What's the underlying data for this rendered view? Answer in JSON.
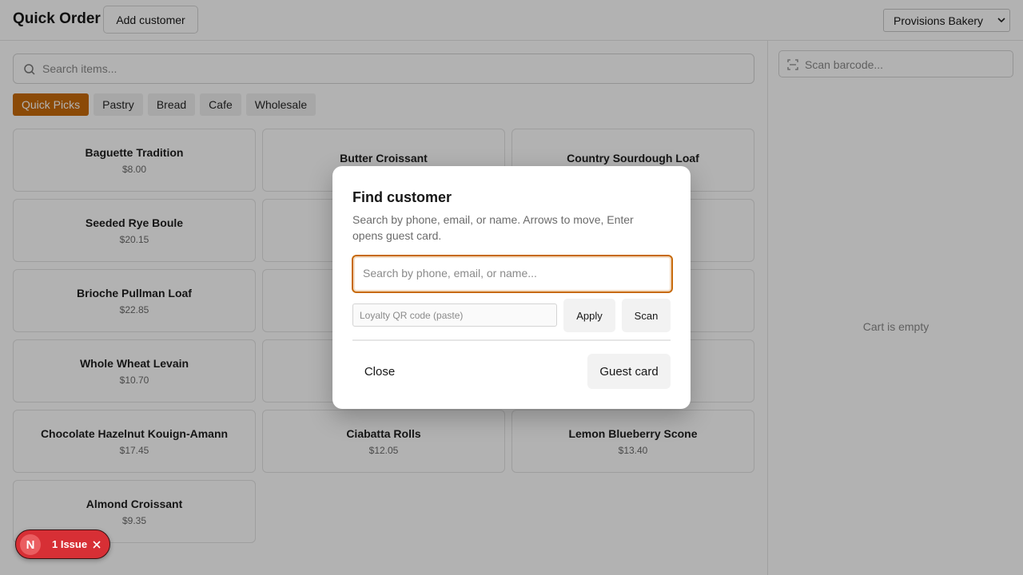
{
  "header": {
    "title": "Quick Order",
    "add_customer_label": "Add customer",
    "store_selected": "Provisions Bakery"
  },
  "search": {
    "placeholder": "Search items..."
  },
  "categories": [
    {
      "label": "Quick Picks",
      "active": true
    },
    {
      "label": "Pastry",
      "active": false
    },
    {
      "label": "Bread",
      "active": false
    },
    {
      "label": "Cafe",
      "active": false
    },
    {
      "label": "Wholesale",
      "active": false
    }
  ],
  "items": [
    {
      "name": "Baguette Tradition",
      "price": "$8.00"
    },
    {
      "name": "Butter Croissant",
      "price": ""
    },
    {
      "name": "Country Sourdough Loaf",
      "price": ""
    },
    {
      "name": "Seeded Rye Boule",
      "price": "$20.15"
    },
    {
      "name": "",
      "price": ""
    },
    {
      "name": "",
      "price": ""
    },
    {
      "name": "Brioche Pullman Loaf",
      "price": "$22.85"
    },
    {
      "name": "",
      "price": ""
    },
    {
      "name": "",
      "price": ""
    },
    {
      "name": "Whole Wheat Levain",
      "price": "$10.70"
    },
    {
      "name": "",
      "price": ""
    },
    {
      "name": "",
      "price": ""
    },
    {
      "name": "Chocolate Hazelnut Kouign-Amann",
      "price": "$17.45"
    },
    {
      "name": "Ciabatta Rolls",
      "price": "$12.05"
    },
    {
      "name": "Lemon Blueberry Scone",
      "price": "$13.40"
    },
    {
      "name": "Almond Croissant",
      "price": "$9.35"
    }
  ],
  "cart": {
    "barcode_placeholder": "Scan barcode...",
    "empty_text": "Cart is empty"
  },
  "modal": {
    "title": "Find customer",
    "description": "Search by phone, email, or name. Arrows to move, Enter opens guest card.",
    "search_placeholder": "Search by phone, email, or name...",
    "qr_placeholder": "Loyalty QR code (paste)",
    "apply_label": "Apply",
    "scan_label": "Scan",
    "close_label": "Close",
    "guest_card_label": "Guest card"
  },
  "issue_badge": {
    "avatar_letter": "N",
    "text": "1 Issue"
  },
  "colors": {
    "accent": "#c76a0b",
    "issue_red": "#d72f35"
  }
}
